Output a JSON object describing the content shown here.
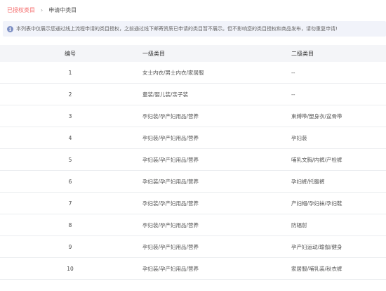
{
  "breadcrumb": {
    "parent": "已授权类目",
    "separator": "›",
    "current": "申请中类目"
  },
  "notice": {
    "icon": "info-icon",
    "text": "本列表中仅展示您通过线上流程申请的类目授权，之前通过线下邮寄资质已申请的类目暂不展示。但不影响您的类目授权和商品发布，请勿重复申请!"
  },
  "table": {
    "headers": {
      "index": "编号",
      "category1": "一级类目",
      "category2": "二级类目"
    },
    "rows": [
      {
        "index": "1",
        "category1": "女士内衣/男士内衣/家居服",
        "category2": "--"
      },
      {
        "index": "2",
        "category1": "童装/婴儿装/亲子装",
        "category2": "--"
      },
      {
        "index": "3",
        "category1": "孕妇装/孕产妇用品/营养",
        "category2": "束缚带/塑身衣/盆骨带"
      },
      {
        "index": "4",
        "category1": "孕妇装/孕产妇用品/营养",
        "category2": "孕妇装"
      },
      {
        "index": "5",
        "category1": "孕妇装/孕产妇用品/营养",
        "category2": "哺乳文胸/内裤/产检裤"
      },
      {
        "index": "6",
        "category1": "孕妇装/孕产妇用品/营养",
        "category2": "孕妇裤/托腹裤"
      },
      {
        "index": "7",
        "category1": "孕妇装/孕产妇用品/营养",
        "category2": "产妇帽/孕妇袜/孕妇鞋"
      },
      {
        "index": "8",
        "category1": "孕妇装/孕产妇用品/营养",
        "category2": "防辐射"
      },
      {
        "index": "9",
        "category1": "孕妇装/孕产妇用品/营养",
        "category2": "孕产妇运动/瑜伽/健身"
      },
      {
        "index": "10",
        "category1": "孕妇装/孕产妇用品/营养",
        "category2": "家居服/哺乳装/秋衣裤"
      }
    ]
  }
}
